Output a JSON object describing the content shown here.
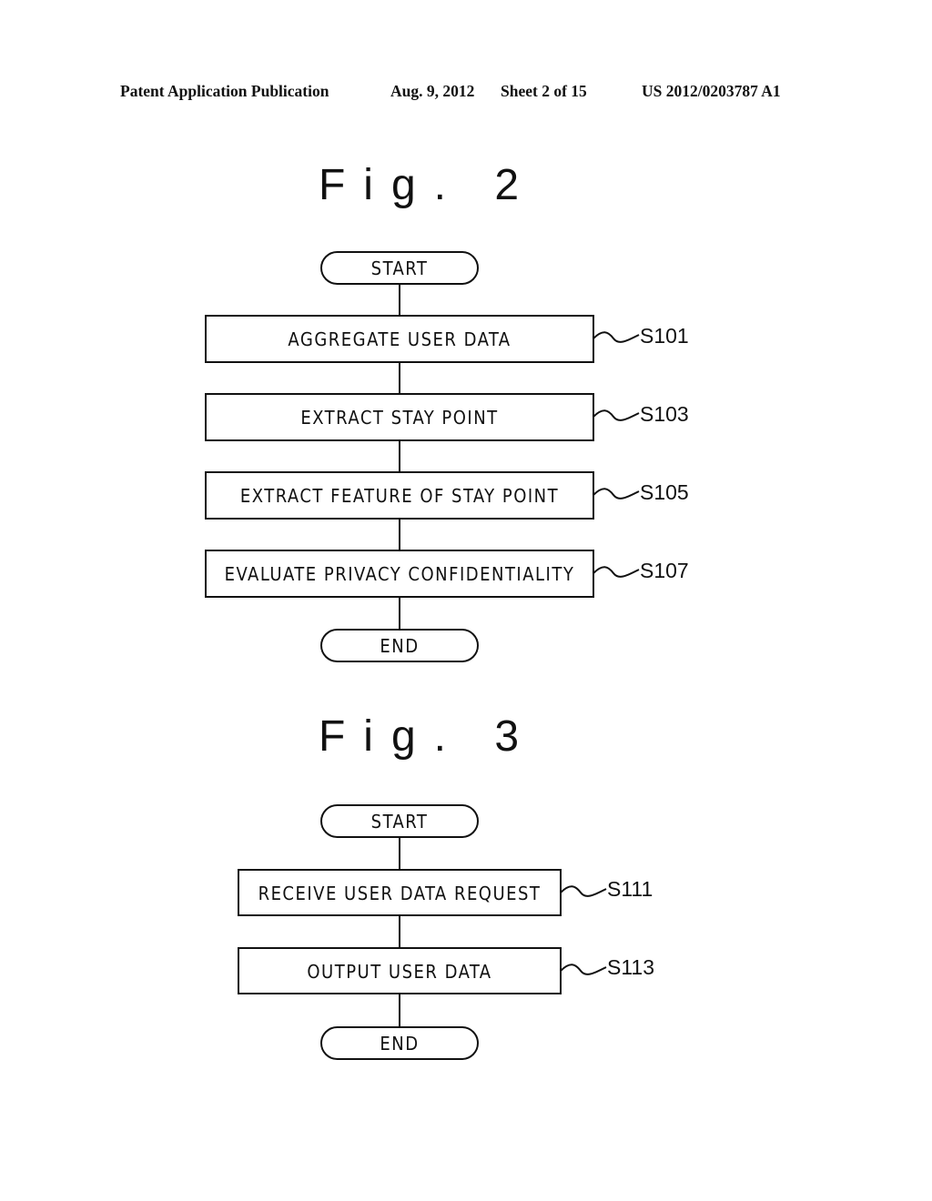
{
  "header": {
    "publication_type": "Patent Application Publication",
    "date": "Aug. 9, 2012",
    "sheet": "Sheet 2 of 15",
    "patent_number": "US 2012/0203787 A1"
  },
  "figures": [
    {
      "title": "Fig. 2",
      "start_label": "START",
      "end_label": "END",
      "steps": [
        {
          "text": "AGGREGATE USER DATA",
          "ref": "S101"
        },
        {
          "text": "EXTRACT STAY POINT",
          "ref": "S103"
        },
        {
          "text": "EXTRACT FEATURE OF STAY POINT",
          "ref": "S105"
        },
        {
          "text": "EVALUATE PRIVACY CONFIDENTIALITY",
          "ref": "S107"
        }
      ]
    },
    {
      "title": "Fig. 3",
      "start_label": "START",
      "end_label": "END",
      "steps": [
        {
          "text": "RECEIVE USER DATA REQUEST",
          "ref": "S111"
        },
        {
          "text": "OUTPUT USER DATA",
          "ref": "S113"
        }
      ]
    }
  ]
}
